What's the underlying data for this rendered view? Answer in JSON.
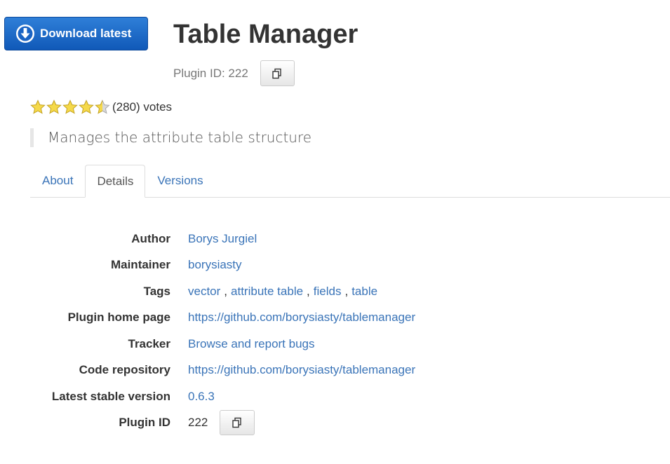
{
  "header": {
    "download_label": "Download latest",
    "title": "Table Manager",
    "plugin_id_text": "Plugin ID: 222"
  },
  "rating": {
    "stars": 4.5,
    "votes_text": "(280) votes"
  },
  "description": "Manages the attribute table structure",
  "tabs": [
    {
      "label": "About",
      "active": false
    },
    {
      "label": "Details",
      "active": true
    },
    {
      "label": "Versions",
      "active": false
    }
  ],
  "details": {
    "author": {
      "label": "Author",
      "value": "Borys Jurgiel"
    },
    "maintainer": {
      "label": "Maintainer",
      "value": "borysiasty"
    },
    "tags": {
      "label": "Tags",
      "values": [
        "vector",
        "attribute table",
        "fields",
        "table"
      ],
      "separator": ","
    },
    "home_page": {
      "label": "Plugin home page",
      "value": "https://github.com/borysiasty/tablemanager"
    },
    "tracker": {
      "label": "Tracker",
      "value": "Browse and report bugs"
    },
    "code_repo": {
      "label": "Code repository",
      "value": "https://github.com/borysiasty/tablemanager"
    },
    "latest_version": {
      "label": "Latest stable version",
      "value": "0.6.3"
    },
    "plugin_id": {
      "label": "Plugin ID",
      "value": "222"
    }
  },
  "colors": {
    "link": "#3a74b8",
    "download_button": "#1a6ac9",
    "star_fill": "#f5d94a"
  },
  "icons": {
    "download": "download-circle-icon",
    "copy": "copy-icon",
    "star": "star-icon"
  }
}
